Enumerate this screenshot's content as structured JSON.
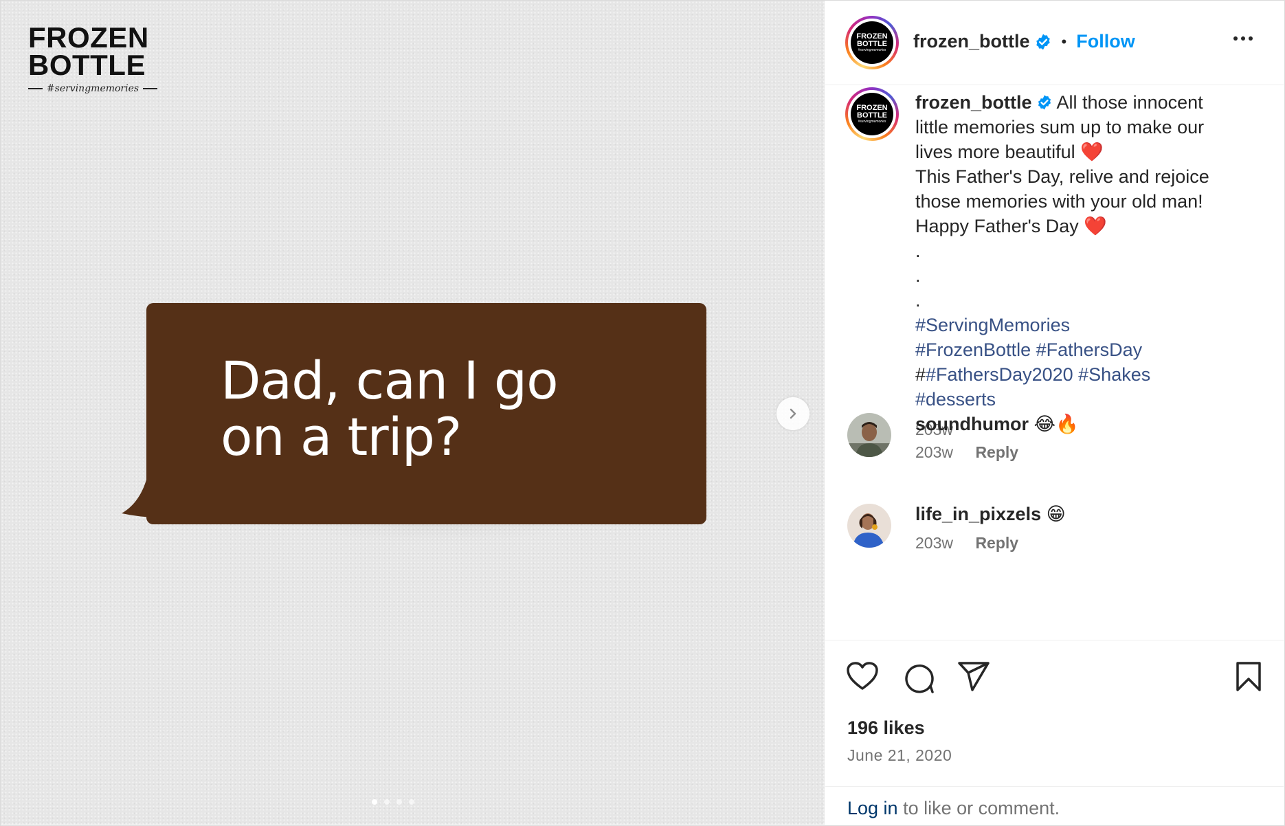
{
  "brand": {
    "line1": "FROZEN",
    "line2": "BOTTLE",
    "tagline": "#servingmemories"
  },
  "media": {
    "bubble_text_line1": "Dad, can I go",
    "bubble_text_line2": "on a trip?",
    "bubble_color": "#553017",
    "next_icon": "chevron-right-icon",
    "carousel_dots": 4,
    "active_dot": 0
  },
  "header": {
    "username": "frozen_bottle",
    "separator": "•",
    "follow_label": "Follow",
    "more_icon": "more-options-icon",
    "accent_color": "#0095f6"
  },
  "caption": {
    "username": "frozen_bottle",
    "lines": [
      "All those innocent",
      "little memories sum up to make our",
      "lives more beautiful",
      "This Father's Day, relive and rejoice",
      "those memories with your old man!",
      "Happy Father's Day"
    ],
    "heart_emoji": "❤️",
    "dots": [
      ".",
      ".",
      "."
    ],
    "hashtags_line1": "#ServingMemories",
    "hashtags_line2": "#FrozenBottle #FathersDay",
    "hashtags_line3_prefix": "#",
    "hashtags_line3": "#FathersDay2020 #Shakes",
    "hashtags_line4": "#desserts",
    "time": "203w"
  },
  "comments": [
    {
      "username": "soundhumor",
      "emoji": "😂🔥",
      "time": "203w",
      "reply_label": "Reply"
    },
    {
      "username": "life_in_pixzels",
      "emoji": "😁",
      "time": "203w",
      "reply_label": "Reply"
    }
  ],
  "actions": {
    "like_icon": "heart-icon",
    "comment_icon": "comment-icon",
    "share_icon": "share-icon",
    "save_icon": "bookmark-icon",
    "likes": "196 likes",
    "date": "June 21, 2020",
    "login_link": "Log in",
    "login_suffix": " to like or comment."
  }
}
